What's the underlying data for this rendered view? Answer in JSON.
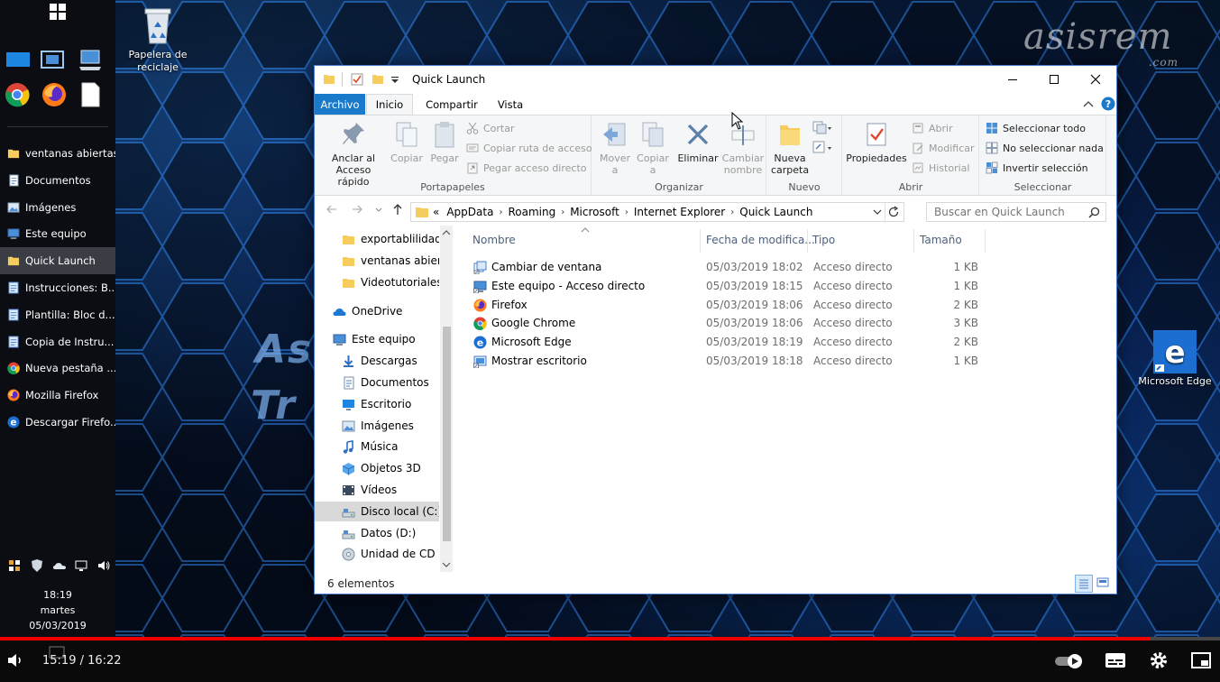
{
  "desktop": {
    "recycle_bin_label": "Papelera de reciclaje",
    "edge_label": "Microsoft Edge",
    "background_text_1": "As",
    "background_text_2": "Tr",
    "watermark": "asisrem",
    "watermark_sub": ".com"
  },
  "taskbar": {
    "items": [
      {
        "label": "ventanas abiertas",
        "icon": "folder-icon",
        "active": false
      },
      {
        "label": "Documentos",
        "icon": "documents-icon",
        "active": false
      },
      {
        "label": "Imágenes",
        "icon": "pictures-icon",
        "active": false
      },
      {
        "label": "Este equipo",
        "icon": "computer-icon",
        "active": false
      },
      {
        "label": "Quick Launch",
        "icon": "folder-icon",
        "active": true
      },
      {
        "label": "Instrucciones: B...",
        "icon": "notepad-icon",
        "active": false
      },
      {
        "label": "Plantilla: Bloc d...",
        "icon": "notepad-icon",
        "active": false
      },
      {
        "label": "Copia de Instru...",
        "icon": "notepad-icon",
        "active": false
      },
      {
        "label": "Nueva pestaña ...",
        "icon": "chrome-icon",
        "active": false
      },
      {
        "label": "Mozilla Firefox",
        "icon": "firefox-icon",
        "active": false
      },
      {
        "label": "Descargar Firefo...",
        "icon": "edge-icon",
        "active": false
      }
    ],
    "clock_time": "18:19",
    "clock_day": "martes",
    "clock_date": "05/03/2019"
  },
  "window": {
    "title": "Quick Launch",
    "tabs": [
      "Archivo",
      "Inicio",
      "Compartir",
      "Vista"
    ],
    "ribbon": {
      "portapapeles": {
        "label": "Portapapeles",
        "anclar": "Anclar al Acceso rápido",
        "copiar": "Copiar",
        "pegar": "Pegar",
        "cortar": "Cortar",
        "copiar_ruta": "Copiar ruta de acceso",
        "pegar_acceso": "Pegar acceso directo"
      },
      "organizar": {
        "label": "Organizar",
        "mover": "Mover a",
        "copiar": "Copiar a",
        "eliminar": "Eliminar",
        "cambiar": "Cambiar nombre"
      },
      "nuevo": {
        "label": "Nuevo",
        "nueva_carpeta": "Nueva carpeta"
      },
      "abrir": {
        "label": "Abrir",
        "propiedades": "Propiedades",
        "abrir": "Abrir",
        "modificar": "Modificar",
        "historial": "Historial"
      },
      "seleccionar": {
        "label": "Seleccionar",
        "todo": "Seleccionar todo",
        "nada": "No seleccionar nada",
        "invertir": "Invertir selección"
      }
    },
    "address": {
      "prefix": "«",
      "crumbs": [
        "AppData",
        "Roaming",
        "Microsoft",
        "Internet Explorer",
        "Quick Launch"
      ]
    },
    "search_placeholder": "Buscar en Quick Launch",
    "nav_pane": [
      {
        "label": "exportablilidad",
        "icon": "folder-icon",
        "state": ""
      },
      {
        "label": "ventanas abierta",
        "icon": "folder-icon",
        "state": ""
      },
      {
        "label": "Videotutoriales",
        "icon": "folder-icon",
        "state": ""
      },
      {
        "label": "OneDrive",
        "icon": "onedrive-icon",
        "state": ""
      },
      {
        "label": "Este equipo",
        "icon": "computer-icon",
        "state": ""
      },
      {
        "label": "Descargas",
        "icon": "downloads-icon",
        "state": ""
      },
      {
        "label": "Documentos",
        "icon": "documents-icon",
        "state": ""
      },
      {
        "label": "Escritorio",
        "icon": "desktop-icon",
        "state": ""
      },
      {
        "label": "Imágenes",
        "icon": "pictures-icon",
        "state": ""
      },
      {
        "label": "Música",
        "icon": "music-icon",
        "state": ""
      },
      {
        "label": "Objetos 3D",
        "icon": "objects3d-icon",
        "state": ""
      },
      {
        "label": "Vídeos",
        "icon": "videos-icon",
        "state": ""
      },
      {
        "label": "Disco local (C:)",
        "icon": "drive-icon",
        "state": "selected"
      },
      {
        "label": "Datos (D:)",
        "icon": "drive-icon",
        "state": ""
      },
      {
        "label": "Unidad de CD (G",
        "icon": "cd-icon",
        "state": ""
      }
    ],
    "columns": {
      "name": "Nombre",
      "date": "Fecha de modifica...",
      "type": "Tipo",
      "size": "Tamaño"
    },
    "files": [
      {
        "name": "Cambiar de ventana",
        "date": "05/03/2019 18:02",
        "type": "Acceso directo",
        "size": "1 KB",
        "icon": "switch-window-icon"
      },
      {
        "name": "Este equipo - Acceso directo",
        "date": "05/03/2019 18:15",
        "type": "Acceso directo",
        "size": "1 KB",
        "icon": "computer-shortcut-icon"
      },
      {
        "name": "Firefox",
        "date": "05/03/2019 18:06",
        "type": "Acceso directo",
        "size": "2 KB",
        "icon": "firefox-icon"
      },
      {
        "name": "Google Chrome",
        "date": "05/03/2019 18:06",
        "type": "Acceso directo",
        "size": "3 KB",
        "icon": "chrome-icon"
      },
      {
        "name": "Microsoft Edge",
        "date": "05/03/2019 18:19",
        "type": "Acceso directo",
        "size": "2 KB",
        "icon": "edge-icon"
      },
      {
        "name": "Mostrar escritorio",
        "date": "05/03/2019 18:18",
        "type": "Acceso directo",
        "size": "1 KB",
        "icon": "show-desktop-icon"
      }
    ],
    "status": "6 elementos"
  },
  "player": {
    "time": "15:19 / 16:22",
    "progress": 0.942
  },
  "colors": {
    "accent": "#1979ca",
    "progress": "#ee0000",
    "selection": "#cce8ff"
  }
}
